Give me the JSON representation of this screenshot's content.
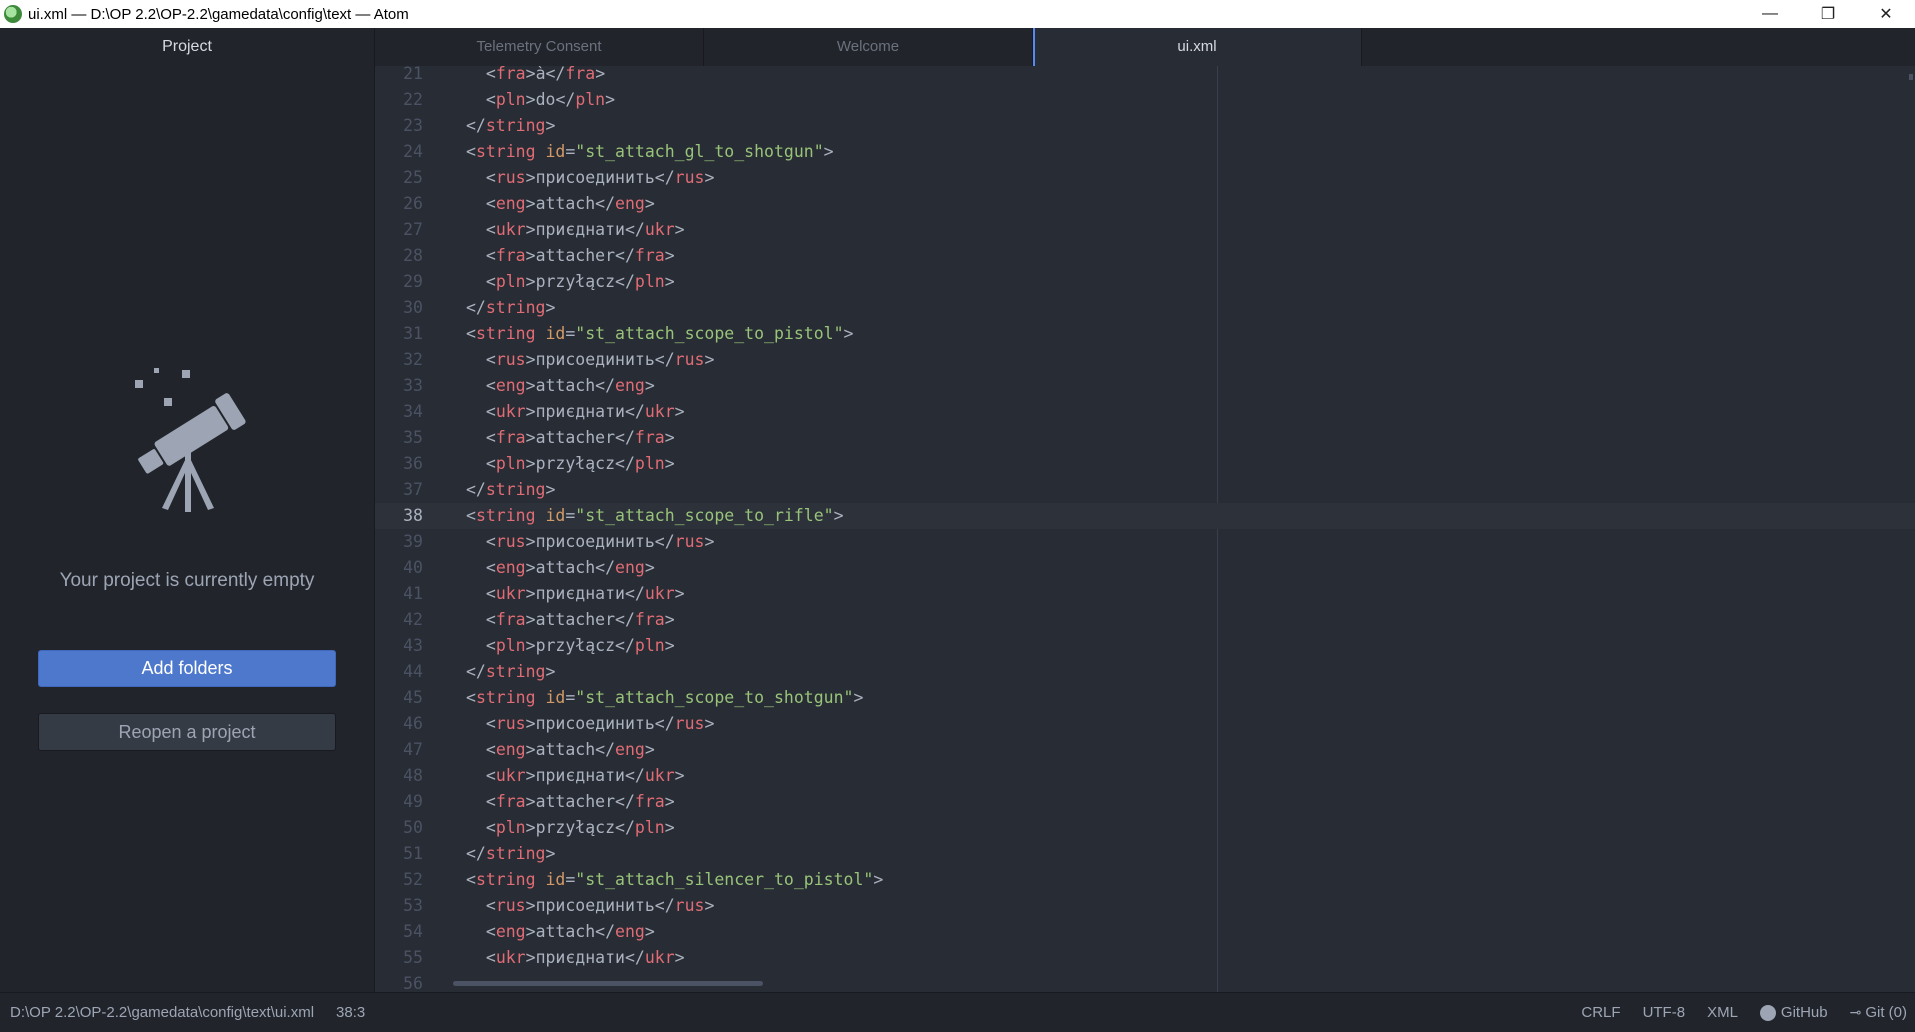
{
  "window": {
    "title": "ui.xml — D:\\OP 2.2\\OP-2.2\\gamedata\\config\\text — Atom",
    "minimize": "—",
    "restore": "❐",
    "close": "✕"
  },
  "sidebar": {
    "tab": "Project",
    "empty_message": "Your project is currently empty",
    "add_folders": "Add folders",
    "reopen": "Reopen a project",
    "icon": "telescope-icon"
  },
  "tabs": [
    {
      "label": "Telemetry Consent",
      "active": false
    },
    {
      "label": "Welcome",
      "active": false
    },
    {
      "label": "ui.xml",
      "active": true
    }
  ],
  "editor": {
    "current_line": 38,
    "lines": [
      {
        "n": "21",
        "indent": 2,
        "kind": "el",
        "tag": "fra",
        "text": "à"
      },
      {
        "n": "22",
        "indent": 2,
        "kind": "el",
        "tag": "pln",
        "text": "do"
      },
      {
        "n": "23",
        "indent": 1,
        "kind": "close",
        "tag": "string"
      },
      {
        "n": "24",
        "indent": 1,
        "kind": "open",
        "tag": "string",
        "attr": "id",
        "value": "st_attach_gl_to_shotgun"
      },
      {
        "n": "25",
        "indent": 2,
        "kind": "el",
        "tag": "rus",
        "text": "присоединить"
      },
      {
        "n": "26",
        "indent": 2,
        "kind": "el",
        "tag": "eng",
        "text": "attach"
      },
      {
        "n": "27",
        "indent": 2,
        "kind": "el",
        "tag": "ukr",
        "text": "приєднати"
      },
      {
        "n": "28",
        "indent": 2,
        "kind": "el",
        "tag": "fra",
        "text": "attacher"
      },
      {
        "n": "29",
        "indent": 2,
        "kind": "el",
        "tag": "pln",
        "text": "przyłącz"
      },
      {
        "n": "30",
        "indent": 1,
        "kind": "close",
        "tag": "string"
      },
      {
        "n": "31",
        "indent": 1,
        "kind": "open",
        "tag": "string",
        "attr": "id",
        "value": "st_attach_scope_to_pistol"
      },
      {
        "n": "32",
        "indent": 2,
        "kind": "el",
        "tag": "rus",
        "text": "присоединить"
      },
      {
        "n": "33",
        "indent": 2,
        "kind": "el",
        "tag": "eng",
        "text": "attach"
      },
      {
        "n": "34",
        "indent": 2,
        "kind": "el",
        "tag": "ukr",
        "text": "приєднати"
      },
      {
        "n": "35",
        "indent": 2,
        "kind": "el",
        "tag": "fra",
        "text": "attacher"
      },
      {
        "n": "36",
        "indent": 2,
        "kind": "el",
        "tag": "pln",
        "text": "przyłącz"
      },
      {
        "n": "37",
        "indent": 1,
        "kind": "close",
        "tag": "string"
      },
      {
        "n": "38",
        "indent": 1,
        "kind": "open",
        "tag": "string",
        "attr": "id",
        "value": "st_attach_scope_to_rifle"
      },
      {
        "n": "39",
        "indent": 2,
        "kind": "el",
        "tag": "rus",
        "text": "присоединить"
      },
      {
        "n": "40",
        "indent": 2,
        "kind": "el",
        "tag": "eng",
        "text": "attach"
      },
      {
        "n": "41",
        "indent": 2,
        "kind": "el",
        "tag": "ukr",
        "text": "приєднати"
      },
      {
        "n": "42",
        "indent": 2,
        "kind": "el",
        "tag": "fra",
        "text": "attacher"
      },
      {
        "n": "43",
        "indent": 2,
        "kind": "el",
        "tag": "pln",
        "text": "przyłącz"
      },
      {
        "n": "44",
        "indent": 1,
        "kind": "close",
        "tag": "string"
      },
      {
        "n": "45",
        "indent": 1,
        "kind": "open",
        "tag": "string",
        "attr": "id",
        "value": "st_attach_scope_to_shotgun"
      },
      {
        "n": "46",
        "indent": 2,
        "kind": "el",
        "tag": "rus",
        "text": "присоединить"
      },
      {
        "n": "47",
        "indent": 2,
        "kind": "el",
        "tag": "eng",
        "text": "attach"
      },
      {
        "n": "48",
        "indent": 2,
        "kind": "el",
        "tag": "ukr",
        "text": "приєднати"
      },
      {
        "n": "49",
        "indent": 2,
        "kind": "el",
        "tag": "fra",
        "text": "attacher"
      },
      {
        "n": "50",
        "indent": 2,
        "kind": "el",
        "tag": "pln",
        "text": "przyłącz"
      },
      {
        "n": "51",
        "indent": 1,
        "kind": "close",
        "tag": "string"
      },
      {
        "n": "52",
        "indent": 1,
        "kind": "open",
        "tag": "string",
        "attr": "id",
        "value": "st_attach_silencer_to_pistol"
      },
      {
        "n": "53",
        "indent": 2,
        "kind": "el",
        "tag": "rus",
        "text": "присоединить"
      },
      {
        "n": "54",
        "indent": 2,
        "kind": "el",
        "tag": "eng",
        "text": "attach"
      },
      {
        "n": "55",
        "indent": 2,
        "kind": "el",
        "tag": "ukr",
        "text": "приєднати"
      },
      {
        "n": "56",
        "indent": 2,
        "kind": "blank"
      }
    ]
  },
  "status": {
    "path": "D:\\OP 2.2\\OP-2.2\\gamedata\\config\\text\\ui.xml",
    "cursor": "38:3",
    "line_ending": "CRLF",
    "encoding": "UTF-8",
    "grammar": "XML",
    "github": "GitHub",
    "git": "Git (0)"
  },
  "colors": {
    "accent": "#4d78cc",
    "tag": "#e06c75",
    "attribute": "#d19a66",
    "string": "#98c379",
    "background": "#282c34"
  }
}
